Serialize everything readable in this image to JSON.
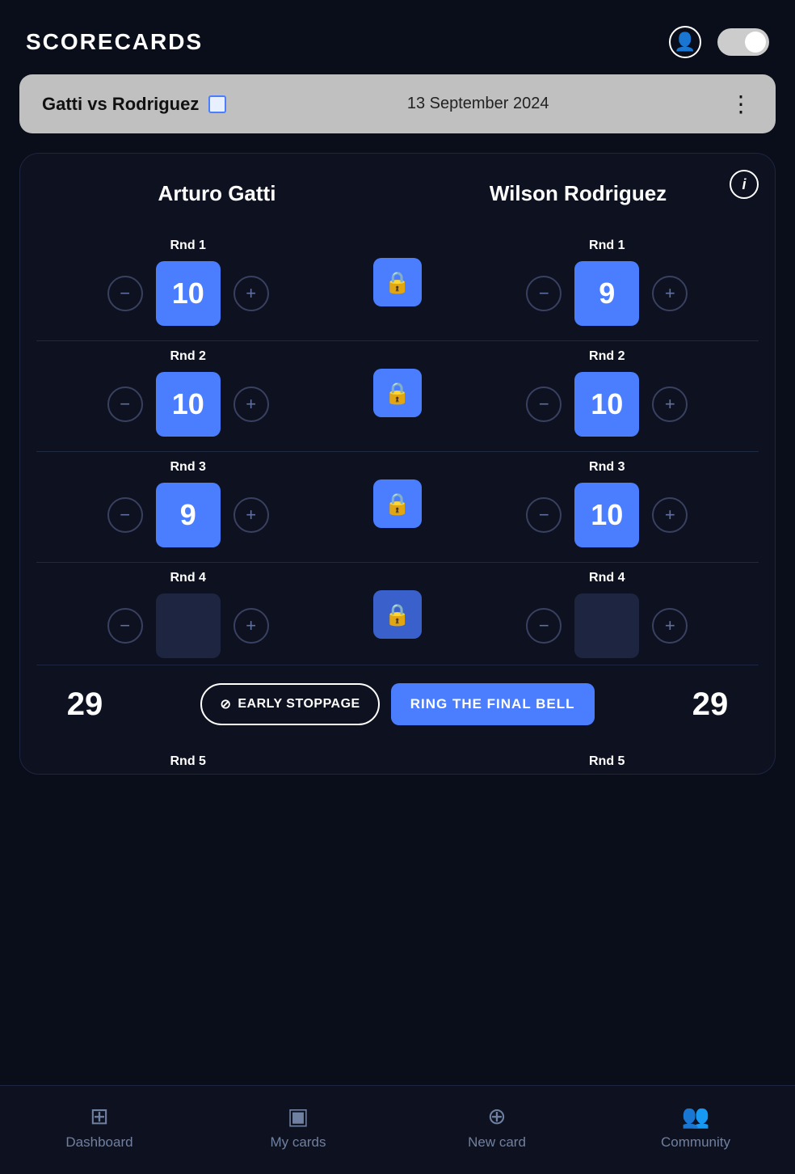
{
  "header": {
    "title": "SCORECARDS",
    "toggle_state": "on"
  },
  "fight": {
    "name": "Gatti vs Rodriguez",
    "date": "13 September 2024"
  },
  "fighters": {
    "left": {
      "name": "Arturo Gatti",
      "total": "29"
    },
    "right": {
      "name": "Wilson Rodriguez",
      "total": "29"
    }
  },
  "rounds": [
    {
      "label": "Rnd 1",
      "left_score": "10",
      "right_score": "9",
      "locked": true
    },
    {
      "label": "Rnd 2",
      "left_score": "10",
      "right_score": "10",
      "locked": true
    },
    {
      "label": "Rnd 3",
      "left_score": "9",
      "right_score": "10",
      "locked": true
    },
    {
      "label": "Rnd 4",
      "left_score": "",
      "right_score": "",
      "locked": true
    }
  ],
  "rnd5_label_left": "Rnd 5",
  "rnd5_label_right": "Rnd 5",
  "bottom_actions": {
    "early_stoppage_label": "EARLY STOPPAGE",
    "ring_bell_label": "RING THE FINAL BELL"
  },
  "nav": {
    "items": [
      {
        "label": "Dashboard",
        "icon": "⊞",
        "active": false
      },
      {
        "label": "My cards",
        "icon": "▣",
        "active": false
      },
      {
        "label": "New card",
        "icon": "⊕",
        "active": false
      },
      {
        "label": "Community",
        "icon": "👥",
        "active": false
      }
    ]
  },
  "icons": {
    "info": "i",
    "lock": "🔒",
    "minus": "−",
    "plus": "+",
    "ban": "⊘"
  }
}
